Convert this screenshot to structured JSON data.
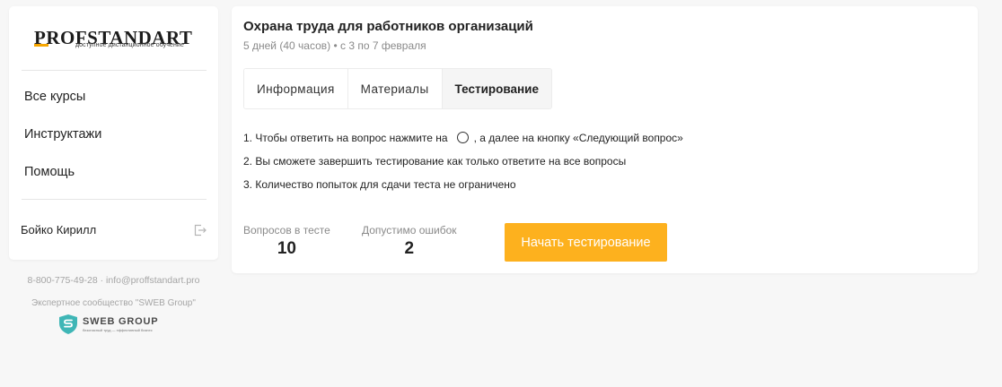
{
  "sidebar": {
    "logo": {
      "name": "PROFSTANDART",
      "tagline": "доступное дистанционное обучение"
    },
    "nav": [
      {
        "label": "Все курсы"
      },
      {
        "label": "Инструктажи"
      },
      {
        "label": "Помощь"
      }
    ],
    "user": {
      "name": "Бойко Кирилл",
      "logout_icon": "logout-icon"
    }
  },
  "footer": {
    "contacts": "8-800-775-49-28 · info@proffstandart.pro",
    "community": "Экспертное сообщество \"SWEB Group\"",
    "partner_logo": {
      "name": "SWEB GROUP",
      "tagline": "безопасный труд — эффективный бизнес"
    }
  },
  "course": {
    "title": "Охрана труда для работников организаций",
    "meta": "5 дней (40 часов) • с 3 по 7 февраля"
  },
  "tabs": [
    {
      "label": "Информация",
      "active": false
    },
    {
      "label": "Материалы",
      "active": false
    },
    {
      "label": "Тестирование",
      "active": true
    }
  ],
  "instructions": {
    "line1_before": "1. Чтобы ответить на вопрос нажмите на",
    "line1_after": ", а далее на кнопку «Следующий вопрос»",
    "line2": "2. Вы сможете завершить тестирование как только ответите на все вопросы",
    "line3": "3. Количество попыток для сдачи теста не ограничено"
  },
  "stats": {
    "questions": {
      "label": "Вопросов в тесте",
      "value": "10"
    },
    "errors": {
      "label": "Допустимо ошибок",
      "value": "2"
    }
  },
  "start_button": {
    "label": "Начать тестирование"
  },
  "colors": {
    "accent": "#fdb11e",
    "logo_bar": "#f7a600",
    "muted_text": "#8a8a8a",
    "sweb_teal": "#3fb6b6"
  }
}
